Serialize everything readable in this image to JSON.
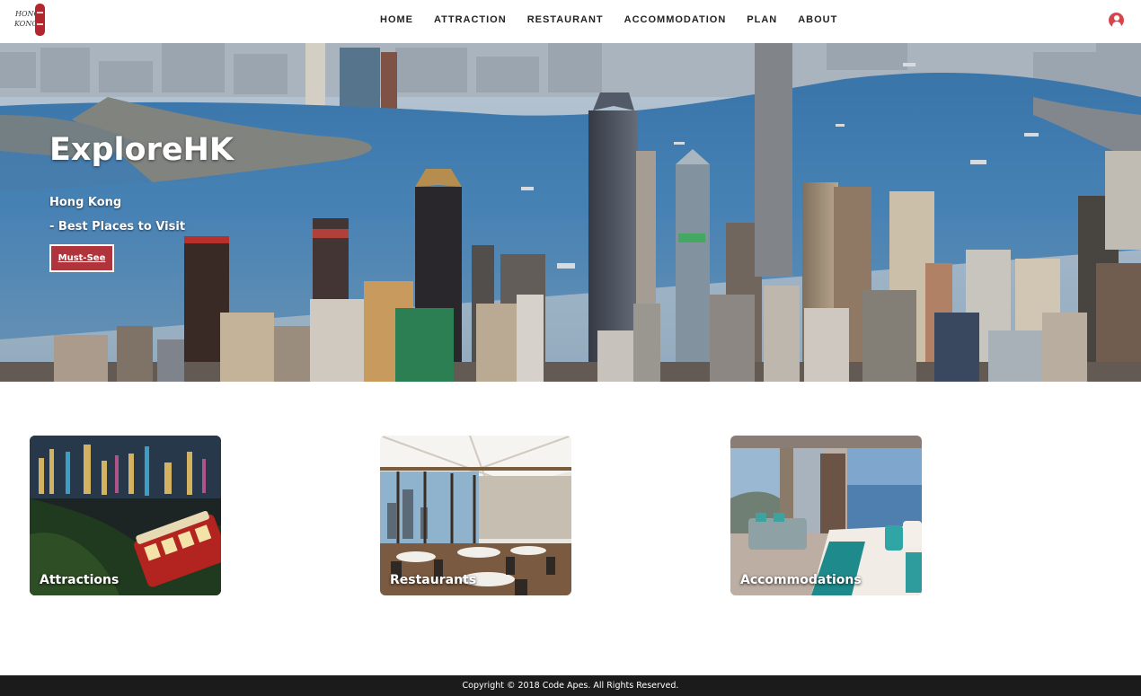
{
  "header": {
    "logo": {
      "line1": "HONG",
      "line2": "KONG"
    },
    "nav": [
      "HOME",
      "ATTRACTION",
      "RESTAURANT",
      "ACCOMMODATION",
      "PLAN",
      "ABOUT"
    ],
    "user_icon": "user-circle-icon",
    "accent_color": "#d8444b"
  },
  "hero": {
    "title": "ExploreHK",
    "subtitle_line1": "Hong Kong",
    "subtitle_line2": "- Best Places to Visit",
    "button_label": "Must-See",
    "button_color": "#b0343b"
  },
  "cards": [
    {
      "label": "Attractions"
    },
    {
      "label": "Restaurants"
    },
    {
      "label": "Accommodations"
    }
  ],
  "footer": {
    "copyright": "Copyright © 2018 Code Apes. All Rights Reserved."
  }
}
